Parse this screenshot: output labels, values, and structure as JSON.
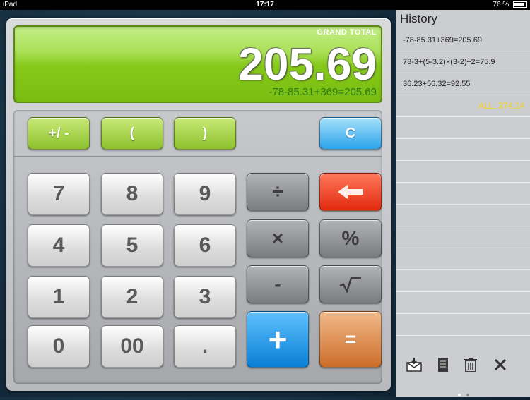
{
  "status_bar": {
    "device": "iPad",
    "time": "17:17",
    "battery": "76 %"
  },
  "display": {
    "label": "GRAND TOTAL",
    "value": "205.69",
    "expression": "-78-85.31+369=205.69"
  },
  "function_row": {
    "plus_minus": "+/ -",
    "open_paren": "(",
    "close_paren": ")",
    "clear": "C"
  },
  "keypad": {
    "k7": "7",
    "k8": "8",
    "k9": "9",
    "k4": "4",
    "k5": "5",
    "k6": "6",
    "k1": "1",
    "k2": "2",
    "k3": "3",
    "k0": "0",
    "k00": "00",
    "kdot": ".",
    "divide": "÷",
    "multiply": "×",
    "minus": "-",
    "plus": "+",
    "percent": "%",
    "sqrt": "√‾",
    "equals": "="
  },
  "history": {
    "title": "History",
    "entries": [
      "-78-85.31+369=205.69",
      "78-3+(5-3.2)×(3-2)÷2=75.9",
      "36.23+56.32=92.55"
    ],
    "total": "ALL: 374.14",
    "toolbar_icons": [
      "mail-icon",
      "notes-icon",
      "trash-icon",
      "close-icon"
    ]
  },
  "colors": {
    "display_green": "#86c91a",
    "backspace_red": "#e3280d",
    "plus_blue": "#0a7fd5",
    "equals_orange": "#cc6d29",
    "total_yellow": "#f5d40f"
  }
}
